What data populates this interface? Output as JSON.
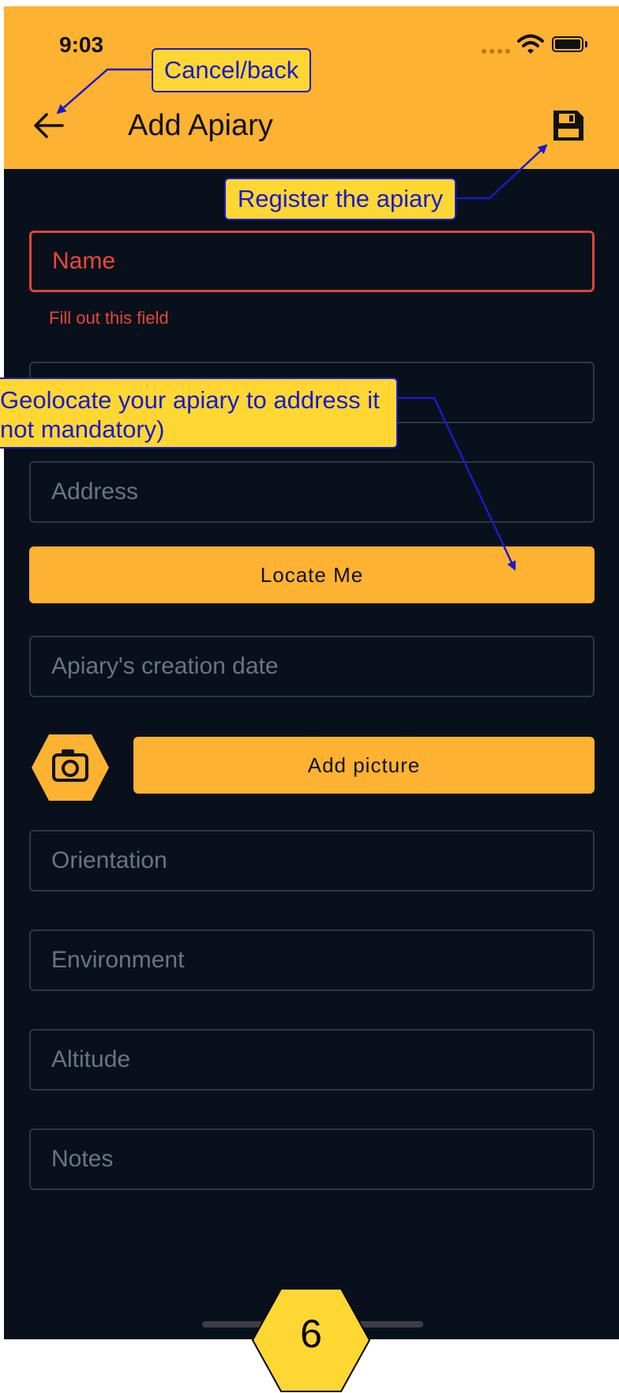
{
  "status_bar": {
    "time": "9:03"
  },
  "header": {
    "title": "Add Apiary"
  },
  "form": {
    "name_placeholder": "Name",
    "name_error": "Fill out this field",
    "address_placeholder": "Address",
    "locate_label": "Locate Me",
    "creation_date_placeholder": "Apiary's creation date",
    "add_picture_label": "Add picture",
    "orientation_placeholder": "Orientation",
    "environment_placeholder": "Environment",
    "altitude_placeholder": "Altitude",
    "notes_placeholder": "Notes"
  },
  "annotations": {
    "cancel": "Cancel/back",
    "register": "Register the apiary",
    "geolocate_line1": "Geolocate your apiary to address it",
    "geolocate_line2": "not mandatory)"
  },
  "step_badge": "6",
  "colors": {
    "accent": "#fdb231",
    "background": "#08111b",
    "error": "#e0443b",
    "annotation_bg": "#fed733",
    "annotation_text": "#1a1acc"
  }
}
